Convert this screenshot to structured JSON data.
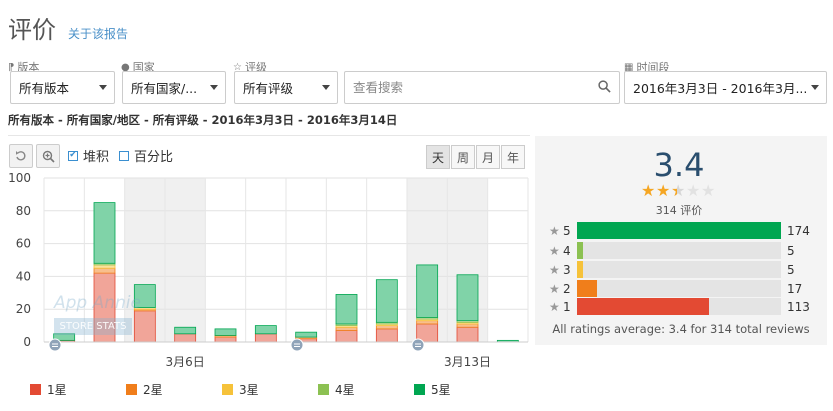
{
  "header": {
    "title": "评价",
    "report_link": "关于该报告"
  },
  "filters": {
    "version": {
      "label": "版本",
      "value": "所有版本"
    },
    "country": {
      "label": "国家",
      "value": "所有国家/..."
    },
    "rating": {
      "label": "评级",
      "value": "所有评级"
    },
    "search": {
      "placeholder": "查看搜索",
      "value": ""
    },
    "period": {
      "label": "时间段",
      "value": "2016年3月3日 - 2016年3月..."
    }
  },
  "summary": "所有版本 - 所有国家/地区 - 所有评级 - 2016年3月3日 - 2016年3月14日",
  "toolbar": {
    "stacked_label": "堆积",
    "percent_label": "百分比",
    "stacked_checked": true,
    "percent_checked": false
  },
  "periods": [
    {
      "label": "天",
      "active": true
    },
    {
      "label": "周",
      "active": false
    },
    {
      "label": "月",
      "active": false
    },
    {
      "label": "年",
      "active": false
    }
  ],
  "chart_data": {
    "type": "bar",
    "stacked": true,
    "x": [
      "2016-03-03",
      "2016-03-04",
      "2016-03-05",
      "2016-03-06",
      "2016-03-07",
      "2016-03-08",
      "2016-03-09",
      "2016-03-10",
      "2016-03-11",
      "2016-03-12",
      "2016-03-13",
      "2016-03-14"
    ],
    "x_tick_labels": [
      {
        "index": 3,
        "label": "3月6日"
      },
      {
        "index": 10,
        "label": "3月13日"
      }
    ],
    "y_ticks": [
      0,
      20,
      40,
      60,
      80,
      100
    ],
    "ylim": [
      0,
      100
    ],
    "series": [
      {
        "name": "1星",
        "color": "#e34a33",
        "values": [
          1,
          42,
          19,
          5,
          3,
          5,
          2,
          7,
          8,
          11,
          9,
          0
        ]
      },
      {
        "name": "2星",
        "color": "#f07e1b",
        "values": [
          0,
          3,
          1,
          0,
          1,
          0,
          1,
          2,
          2,
          2,
          2,
          0
        ]
      },
      {
        "name": "3星",
        "color": "#f6c23a",
        "values": [
          0,
          2,
          1,
          0,
          0,
          0,
          0,
          1,
          1,
          1,
          1,
          0
        ]
      },
      {
        "name": "4星",
        "color": "#8cc152",
        "values": [
          0,
          1,
          0,
          0,
          0,
          0,
          0,
          1,
          1,
          1,
          1,
          0
        ]
      },
      {
        "name": "5星",
        "color": "#00a651",
        "values": [
          4,
          37,
          14,
          4,
          4,
          5,
          3,
          18,
          26,
          32,
          28,
          1
        ]
      }
    ],
    "shaded_weekend_indices": [
      2,
      3,
      9,
      10
    ],
    "annotation_indices": [
      0,
      6,
      9
    ]
  },
  "watermark": {
    "line1": "App Annie",
    "line2": "STORE STATS"
  },
  "ratings": {
    "average": "3.4",
    "average_value": 3.4,
    "count_label": "314 评价",
    "rows": [
      {
        "star": "5",
        "count": 174,
        "color": "#00a651"
      },
      {
        "star": "4",
        "count": 5,
        "color": "#8cc152"
      },
      {
        "star": "3",
        "count": 5,
        "color": "#f6c23a"
      },
      {
        "star": "2",
        "count": 17,
        "color": "#f07e1b"
      },
      {
        "star": "1",
        "count": 113,
        "color": "#e34a33"
      }
    ],
    "footer": "All ratings average: 3.4 for 314 total reviews"
  }
}
